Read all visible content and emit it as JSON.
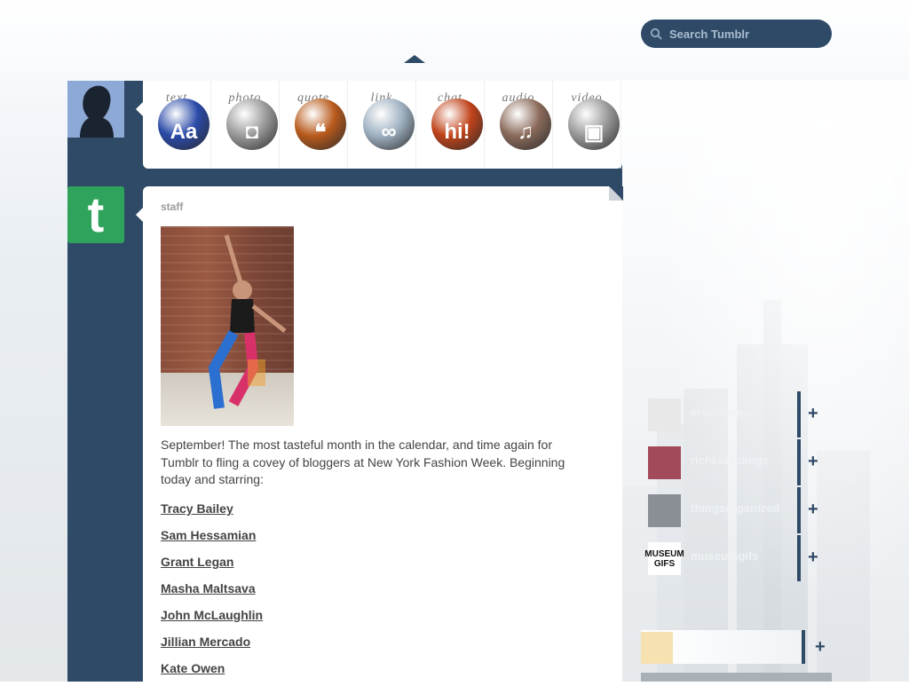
{
  "search": {
    "placeholder": "Search Tumblr"
  },
  "post_types": [
    {
      "label": "text",
      "icon": "text-aa-icon",
      "glyph": "Aa",
      "color": "#2a4aa8"
    },
    {
      "label": "photo",
      "icon": "camera-icon",
      "glyph": "◘",
      "color": "#9a9a9a"
    },
    {
      "label": "quote",
      "icon": "quote-icon",
      "glyph": "❝",
      "color": "#b85a1c"
    },
    {
      "label": "link",
      "icon": "link-icon",
      "glyph": "∞",
      "color": "#9eb0c0"
    },
    {
      "label": "chat",
      "icon": "chat-hi-icon",
      "glyph": "hi!",
      "color": "#c0431a"
    },
    {
      "label": "audio",
      "icon": "headphones-icon",
      "glyph": "♫",
      "color": "#8a6a5a"
    },
    {
      "label": "video",
      "icon": "video-camera-icon",
      "glyph": "▣",
      "color": "#9a9a9a"
    }
  ],
  "staff_avatar": {
    "letter": "t",
    "color": "#2fa35b"
  },
  "post": {
    "author": "staff",
    "caption": "September! The most tasteful month in the calendar, and time again for Tumblr to fling a covey of bloggers at New York Fashion Week. Beginning today and starring:",
    "links": [
      "Tracy Bailey",
      "Sam Hessamian",
      "Grant Legan",
      "Masha Maltsava",
      "John McLaughlin",
      "Jillian Mercado",
      "Kate Owen"
    ]
  },
  "recommended": [
    {
      "name": "ersdoingnor",
      "thumb": "papers-doing-normal-thumb"
    },
    {
      "name": "richkidsplings",
      "thumb": "rich-kids-thumb"
    },
    {
      "name": "thingsorganized",
      "thumb": "things-organized-thumb"
    },
    {
      "name": "museumgifs",
      "thumb": "museum-gifs-thumb",
      "thumb_text": "MUSEUM GIFS"
    }
  ],
  "colors": {
    "dashboard": "#2f4a67",
    "accent_green": "#2fa35b"
  }
}
